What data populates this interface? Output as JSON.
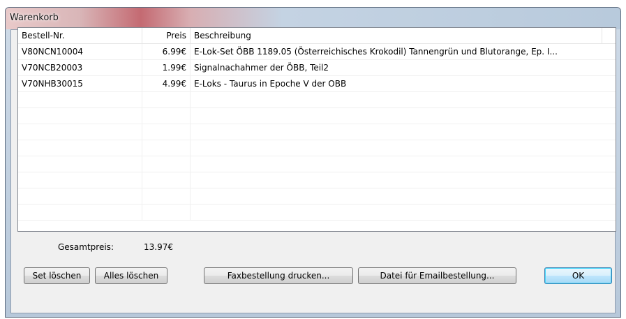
{
  "window": {
    "title": "Warenkorb"
  },
  "table": {
    "columns": [
      "Bestell-Nr.",
      "Preis",
      "Beschreibung"
    ],
    "rows": [
      {
        "order_no": "V80NCN10004",
        "price": "6.99€",
        "description": "E-Lok-Set ÖBB 1189.05 (Österreichisches Krokodil) Tannengrün und Blutorange, Ep. I..."
      },
      {
        "order_no": "V70NCB20003",
        "price": "1.99€",
        "description": "Signalnachahmer der ÖBB, Teil2"
      },
      {
        "order_no": "V70NHB30015",
        "price": "4.99€",
        "description": "E-Loks - Taurus in Epoche V der OBB"
      }
    ]
  },
  "summary": {
    "total_label": "Gesamtpreis:",
    "total_value": "13.97€"
  },
  "buttons": {
    "set_delete": "Set löschen",
    "delete_all": "Alles löschen",
    "fax_print": "Faxbestellung drucken...",
    "email_file": "Datei für Emailbestellung...",
    "ok": "OK"
  }
}
